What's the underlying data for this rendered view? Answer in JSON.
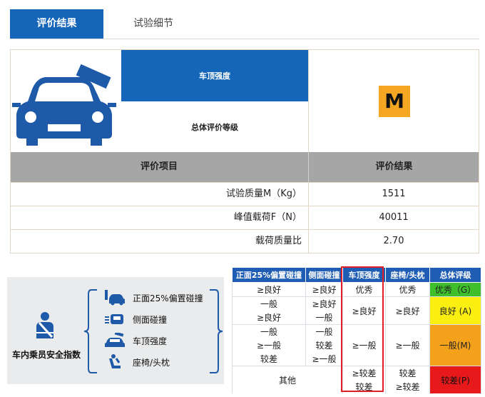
{
  "tabs": [
    {
      "label": "评价结果",
      "active": true
    },
    {
      "label": "试验细节",
      "active": false
    }
  ],
  "card": {
    "title": "车顶强度",
    "subtitle": "总体评价等级",
    "grade": "M",
    "grade_color": "#f5a623",
    "header": {
      "item": "评价项目",
      "result": "评价结果"
    },
    "rows": [
      {
        "label": "试验质量M（Kg）",
        "value": "1511"
      },
      {
        "label": "峰值载荷F（N）",
        "value": "40011"
      },
      {
        "label": "载荷质量比",
        "value": "2.70"
      }
    ]
  },
  "index_panel": {
    "label": "车内乘员安全指数",
    "icon": "seated-occupant-seatbelt-icon",
    "items": [
      {
        "label": "正面25%偏置碰撞",
        "icon": "front-offset-crash-icon"
      },
      {
        "label": "侧面碰撞",
        "icon": "side-crash-icon"
      },
      {
        "label": "车顶强度",
        "icon": "roof-crush-icon"
      },
      {
        "label": "座椅/头枕",
        "icon": "seat-headrest-icon"
      }
    ]
  },
  "matrix": {
    "headers": [
      "正面25%偏置碰撞",
      "侧面碰撞",
      "车顶强度",
      "座椅/头枕",
      "总体评级"
    ],
    "highlight_color": "#e01f26",
    "cells": {
      "r1": [
        "≥良好",
        "≥良好",
        "优秀",
        "优秀",
        "优秀（G）"
      ],
      "r2": [
        "一般",
        "≥良好"
      ],
      "r3": [
        "≥良好",
        "一般"
      ],
      "g2_roof": "≥良好",
      "g2_seat": "≥良好",
      "g2_overall": "良好 (A)",
      "r4": [
        "一般",
        "一般"
      ],
      "r5": [
        "≥一般",
        "较差"
      ],
      "r6": [
        "较差",
        "≥一般"
      ],
      "g3_roof": "≥一般",
      "g3_seat": "≥一般",
      "g3_overall": "一般(M)",
      "other": "其他",
      "r7": [
        "≥较差",
        "较差"
      ],
      "r8": [
        "较差",
        "≥较差"
      ],
      "g4_overall": "较差(P)"
    },
    "grade_colors": {
      "G": "#3fbf2b",
      "A": "#fbee11",
      "M": "#f4a11b",
      "P": "#e8191a"
    }
  }
}
